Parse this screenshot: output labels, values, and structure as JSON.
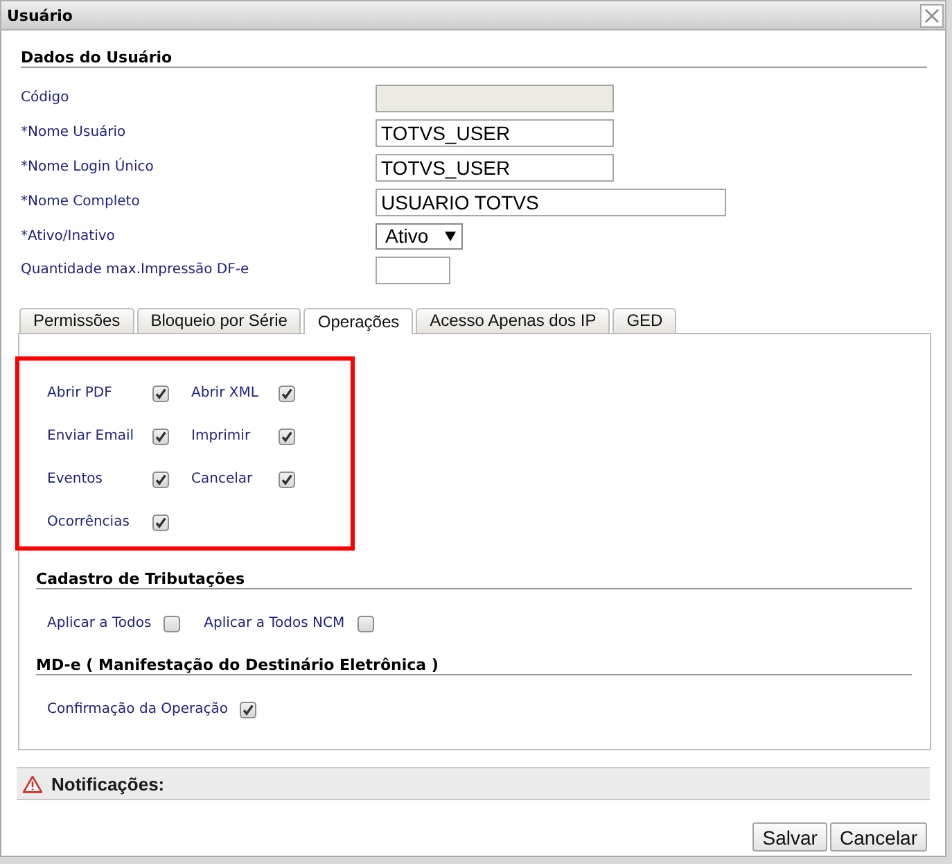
{
  "window": {
    "title": "Usuário"
  },
  "user_data": {
    "heading": "Dados do Usuário",
    "fields": [
      {
        "kind": "text",
        "label": "Código",
        "disabled": true
      },
      {
        "kind": "text",
        "label": "*Nome Usuário",
        "value": "TOTVS_USER",
        "disabled": false
      },
      {
        "kind": "text",
        "label": "*Nome Login Único",
        "value": "TOTVS_USER",
        "disabled": false
      },
      {
        "kind": "long-text",
        "label": "*Nome Completo",
        "value": "USUARIO TOTVS",
        "disabled": false
      },
      {
        "kind": "select",
        "label": "*Ativo/Inativo",
        "value": "Ativo",
        "disabled": false
      },
      {
        "kind": "short-text",
        "label": "Quantidade max.Impressão DF-e",
        "disabled": false
      }
    ]
  },
  "tabs": [
    {
      "label": "Permissões",
      "selected": false
    },
    {
      "label": "Bloqueio por Série",
      "selected": false
    },
    {
      "label": "Operações",
      "selected": true
    },
    {
      "label": "Acesso Apenas dos IP",
      "selected": false
    },
    {
      "label": "GED",
      "selected": false
    }
  ],
  "operations": {
    "highlighted": true,
    "items": [
      {
        "label": "Abrir PDF",
        "checked": true
      },
      {
        "label": "Abrir XML",
        "checked": true
      },
      {
        "label": "Enviar Email",
        "checked": true
      },
      {
        "label": "Imprimir",
        "checked": true
      },
      {
        "label": "Eventos",
        "checked": true
      },
      {
        "label": "Cancelar",
        "checked": true
      },
      {
        "label": "Ocorrências",
        "checked": true
      }
    ]
  },
  "tax_registration": {
    "heading": "Cadastro de Tributações",
    "items": [
      {
        "label": "Aplicar a Todos",
        "checked": false
      },
      {
        "label": "Aplicar a Todos NCM",
        "checked": false
      }
    ]
  },
  "mde": {
    "heading": "MD-e ( Manifestação do Destinário Eletrônica )",
    "items": [
      {
        "label": "Confirmação da Operação",
        "checked": true
      }
    ]
  },
  "notifications": {
    "title": "Notificações:"
  },
  "buttons": [
    "Salvar",
    "Cancelar"
  ]
}
